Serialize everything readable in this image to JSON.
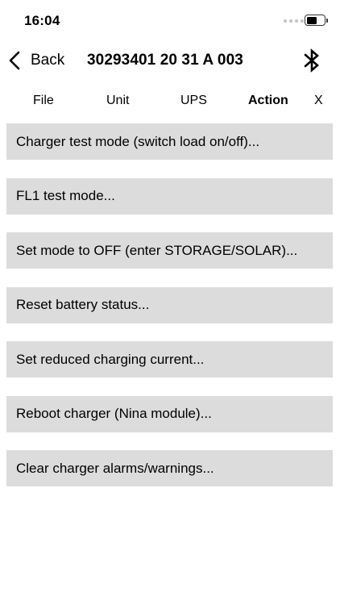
{
  "status": {
    "time": "16:04",
    "battery_level": 0.6
  },
  "nav": {
    "back_label": "Back",
    "title": "30293401 20 31 A 003",
    "bluetooth_icon": "bluetooth-icon"
  },
  "tabs": [
    {
      "label": "File"
    },
    {
      "label": "Unit"
    },
    {
      "label": "UPS"
    },
    {
      "label": "Action",
      "active": true
    },
    {
      "label": "X"
    }
  ],
  "actions": [
    {
      "label": "Charger test mode (switch load on/off)..."
    },
    {
      "label": "FL1 test mode..."
    },
    {
      "label": "Set mode to OFF (enter STORAGE/SOLAR)..."
    },
    {
      "label": "Reset battery status..."
    },
    {
      "label": "Set reduced charging current..."
    },
    {
      "label": "Reboot charger (Nina module)..."
    },
    {
      "label": "Clear charger alarms/warnings..."
    }
  ],
  "colors": {
    "item_background": "#dcdcdc",
    "text": "#000000",
    "background": "#ffffff"
  }
}
